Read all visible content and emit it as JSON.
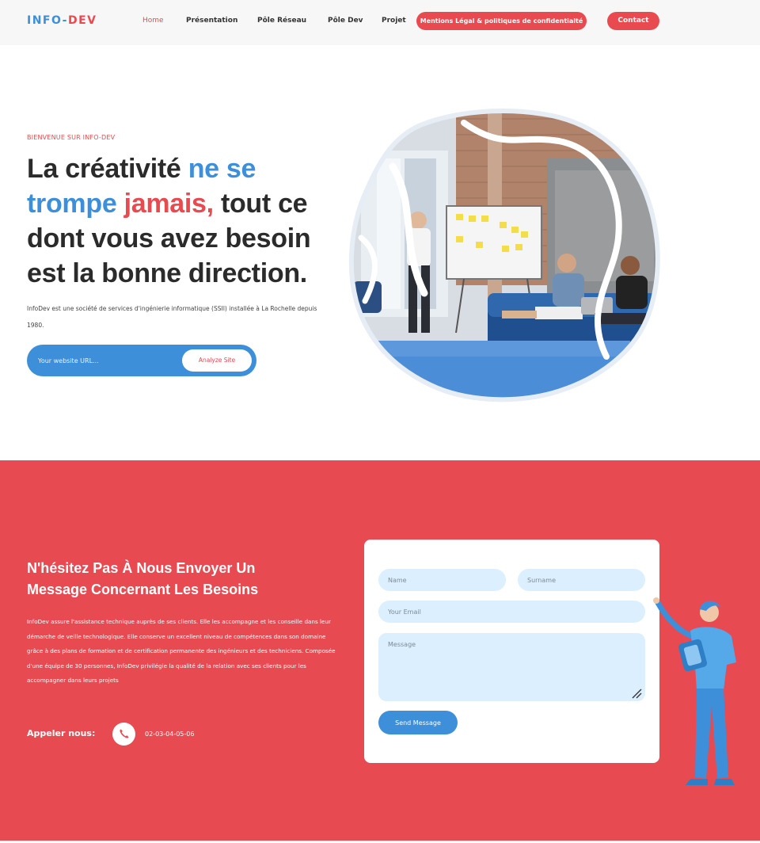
{
  "nav": {
    "logo_left": "INFO-",
    "logo_right": "DEV",
    "links": [
      "Home",
      "Présentation",
      "Pôle Réseau",
      "Pôle Dev",
      "Projet"
    ],
    "legal_label": "Mentions Légal & politiques de confidentialté",
    "contact_label": "Contact"
  },
  "hero": {
    "eyebrow": "BIENVENUE SUR INFO-DEV",
    "headline": {
      "p1": "La créativité ",
      "p2": "ne se",
      "p3": "trompe",
      "p4": " jamais,",
      "p5": " tout ce",
      "p6": "dont vous avez besoin",
      "p7": "est la bonne direction."
    },
    "description": "InfoDev est une société de services d'ingénierie informatique (SSII) installée à La Rochelle depuis 1980.",
    "url_placeholder": "Your website URL...",
    "analyze_label": "Analyze Site"
  },
  "contact": {
    "title": "N'hésitez Pas À Nous Envoyer Un Message Concernant Les Besoins",
    "description": "InfoDev assure l'assistance technique auprès de ses clients. Elle les accompagne et les conseille dans leur démarche de veille technologique. Elle conserve un excellent niveau de compétences dans son domaine grâce à des plans de formation et de certification permanente des ingénieurs et des techniciens. Composée d'une équipe de 30 personnes, InfoDev privilégie la qualité de la relation avec ses clients pour les accompagner dans leurs projets",
    "call_label": "Appeler nous:",
    "phone": "02-03-04-05-06",
    "form": {
      "name_placeholder": "Name",
      "surname_placeholder": "Surname",
      "email_placeholder": "Your Email",
      "message_placeholder": "Message",
      "send_label": "Send Message"
    }
  },
  "colors": {
    "brand_blue": "#3d8fd9",
    "brand_red": "#e84a4f",
    "section_red": "#e84a52",
    "field_blue": "#dcefff"
  },
  "icons": [
    "phone-icon",
    "resize-grip-icon"
  ]
}
